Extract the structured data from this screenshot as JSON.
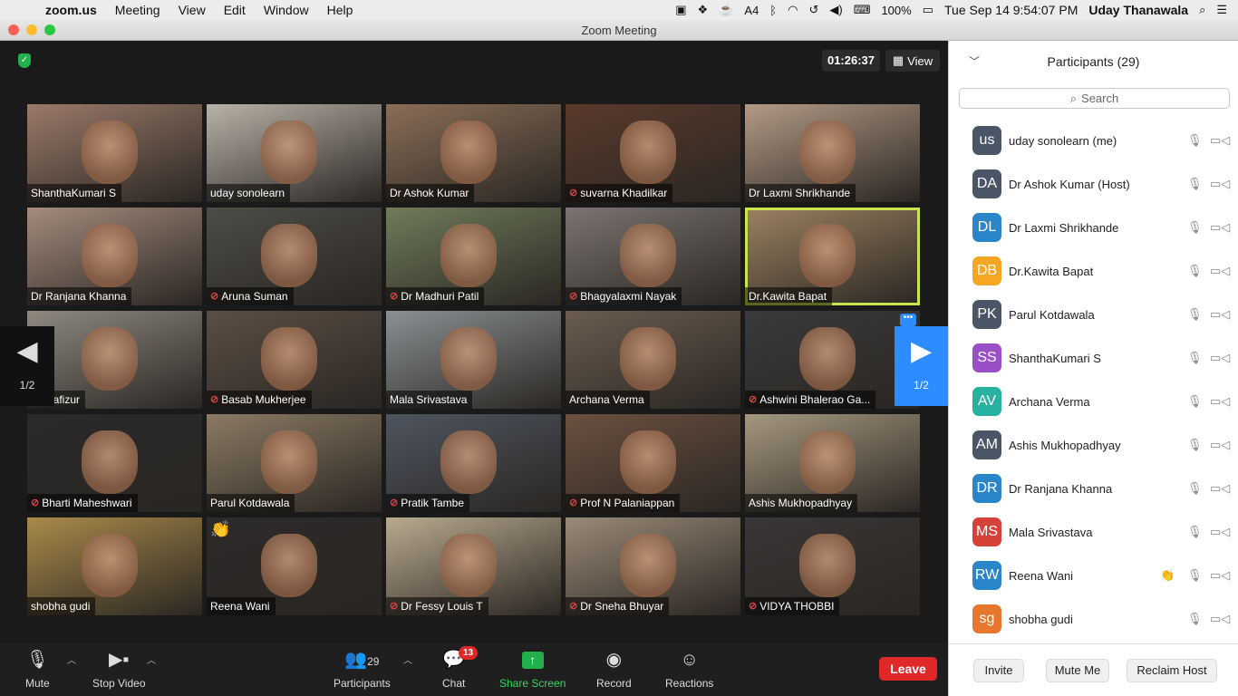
{
  "menubar": {
    "app": "zoom.us",
    "menus": [
      "Meeting",
      "View",
      "Edit",
      "Window",
      "Help"
    ],
    "battery": "100%",
    "clock": "Tue Sep 14  9:54:07 PM",
    "user": "Uday Thanawala",
    "tray_badge": "4"
  },
  "window": {
    "title": "Zoom Meeting"
  },
  "meeting": {
    "timer": "01:26:37",
    "view_label": "View",
    "page_indicator": "1/2",
    "tiles": [
      {
        "name": "ShanthaKumari S",
        "muted": false,
        "color": "#9a7a6a"
      },
      {
        "name": "uday sonolearn",
        "muted": false,
        "color": "#b9b2a8"
      },
      {
        "name": "Dr Ashok Kumar",
        "muted": false,
        "color": "#8a6e58"
      },
      {
        "name": "suvarna Khadilkar",
        "muted": true,
        "color": "#5a3a2c"
      },
      {
        "name": "Dr Laxmi Shrikhande",
        "muted": false,
        "color": "#b39a86"
      },
      {
        "name": "Dr Ranjana Khanna",
        "muted": false,
        "color": "#a48b7d"
      },
      {
        "name": "Aruna Suman",
        "muted": true,
        "color": "#4d4c45"
      },
      {
        "name": "Dr Madhuri Patil",
        "muted": true,
        "color": "#6f7c5b"
      },
      {
        "name": "Bhagyalaxmi Nayak",
        "muted": true,
        "color": "#7b7470"
      },
      {
        "name": "Dr.Kawita Bapat",
        "muted": false,
        "color": "#9c8262"
      },
      {
        "name": "Dr Hafizur",
        "muted": false,
        "color": "#8f8a80"
      },
      {
        "name": "Basab Mukherjee",
        "muted": true,
        "color": "#5b4e44"
      },
      {
        "name": "Mala Srivastava",
        "muted": false,
        "color": "#8a9093"
      },
      {
        "name": "Archana Verma",
        "muted": false,
        "color": "#6a5c50"
      },
      {
        "name": "Ashwini Bhalerao Ga...",
        "muted": true,
        "color": "#3a3a3a"
      },
      {
        "name": "Bharti Maheshwari",
        "muted": true,
        "color": "#2a2a2a"
      },
      {
        "name": "Parul Kotdawala",
        "muted": false,
        "color": "#8b7a64"
      },
      {
        "name": "Pratik Tambe",
        "muted": true,
        "color": "#4e5560"
      },
      {
        "name": "Prof N Palaniappan",
        "muted": true,
        "color": "#6b5040"
      },
      {
        "name": "Ashis Mukhopadhyay",
        "muted": false,
        "color": "#a69880"
      },
      {
        "name": "shobha gudi",
        "muted": false,
        "color": "#a98a4a"
      },
      {
        "name": "Reena Wani",
        "muted": false,
        "color": "#2c2a2a"
      },
      {
        "name": "Dr Fessy Louis T",
        "muted": true,
        "color": "#b9aa90"
      },
      {
        "name": "Dr Sneha Bhuyar",
        "muted": true,
        "color": "#9a8a78"
      },
      {
        "name": "VIDYA THOBBI",
        "muted": true,
        "color": "#3a3636"
      }
    ]
  },
  "toolbar": {
    "mute": "Mute",
    "stop_video": "Stop Video",
    "participants": "Participants",
    "participant_count": "29",
    "chat": "Chat",
    "chat_badge": "13",
    "share_screen": "Share Screen",
    "record": "Record",
    "reactions": "Reactions",
    "leave": "Leave"
  },
  "panel": {
    "title": "Participants (29)",
    "search_placeholder": "Search",
    "participants": [
      {
        "initials": "us",
        "name": "uday sonolearn (me)",
        "color": "#4a5568"
      },
      {
        "initials": "DA",
        "name": "Dr Ashok Kumar (Host)",
        "color": "#4a5568"
      },
      {
        "initials": "DL",
        "name": "Dr Laxmi Shrikhande",
        "color": "#2b86c9"
      },
      {
        "initials": "DB",
        "name": "Dr.Kawita Bapat",
        "color": "#f5a623"
      },
      {
        "initials": "PK",
        "name": "Parul Kotdawala",
        "color": "#4a5568"
      },
      {
        "initials": "SS",
        "name": "ShanthaKumari S",
        "color": "#9b4fc7"
      },
      {
        "initials": "AV",
        "name": "Archana Verma",
        "color": "#26b1a0"
      },
      {
        "initials": "AM",
        "name": "Ashis Mukhopadhyay",
        "color": "#4a5568"
      },
      {
        "initials": "DR",
        "name": "Dr Ranjana Khanna",
        "color": "#2b86c9"
      },
      {
        "initials": "MS",
        "name": "Mala Srivastava",
        "color": "#d6423a"
      },
      {
        "initials": "RW",
        "name": "Reena Wani",
        "color": "#2b86c9"
      },
      {
        "initials": "sg",
        "name": "shobha gudi",
        "color": "#e8772e"
      }
    ],
    "invite": "Invite",
    "mute_me": "Mute Me",
    "reclaim_host": "Reclaim Host"
  }
}
